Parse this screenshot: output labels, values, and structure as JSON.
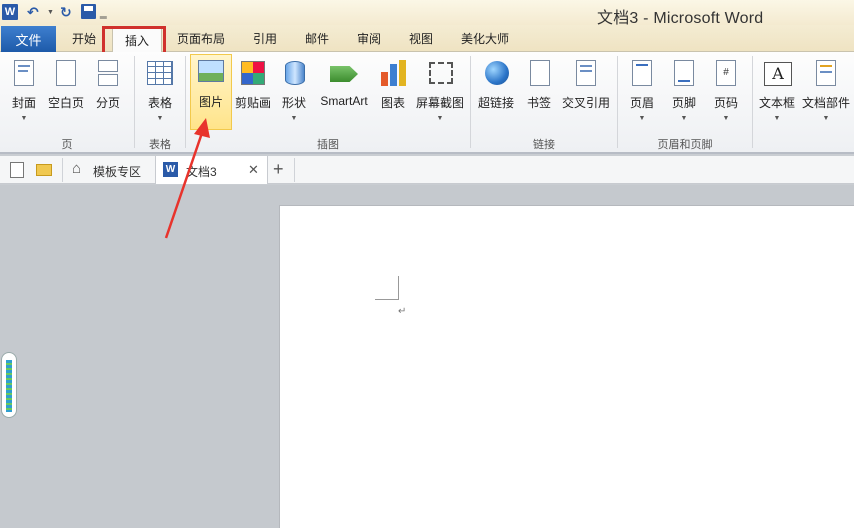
{
  "window": {
    "title": "文档3 - Microsoft Word",
    "logo_letter": "W"
  },
  "ribbon_tabs": {
    "file": "文件",
    "items": [
      "开始",
      "插入",
      "页面布局",
      "引用",
      "邮件",
      "审阅",
      "视图",
      "美化大师"
    ],
    "active": "插入"
  },
  "ribbon": {
    "groups": {
      "pages": {
        "label": "页",
        "buttons": [
          "封面",
          "空白页",
          "分页"
        ]
      },
      "tables": {
        "label": "表格",
        "buttons": [
          "表格"
        ]
      },
      "illustrations": {
        "label": "插图",
        "buttons": [
          "图片",
          "剪贴画",
          "形状",
          "SmartArt",
          "图表",
          "屏幕截图"
        ]
      },
      "links": {
        "label": "链接",
        "buttons": [
          "超链接",
          "书签",
          "交叉引用"
        ]
      },
      "header_footer": {
        "label": "页眉和页脚",
        "buttons": [
          "页眉",
          "页脚",
          "页码"
        ]
      },
      "text": {
        "buttons": [
          "文本框",
          "文档部件"
        ]
      }
    },
    "highlighted_button": "图片"
  },
  "doc_tabs": {
    "template_zone": "模板专区",
    "document": "文档3",
    "close": "✕",
    "new": "+"
  },
  "document": {
    "paragraph_mark": "↵"
  },
  "colors": {
    "accent": "#1d5aa9",
    "annotation_red": "#d0312d",
    "hover_gold": "#ffe48a"
  }
}
